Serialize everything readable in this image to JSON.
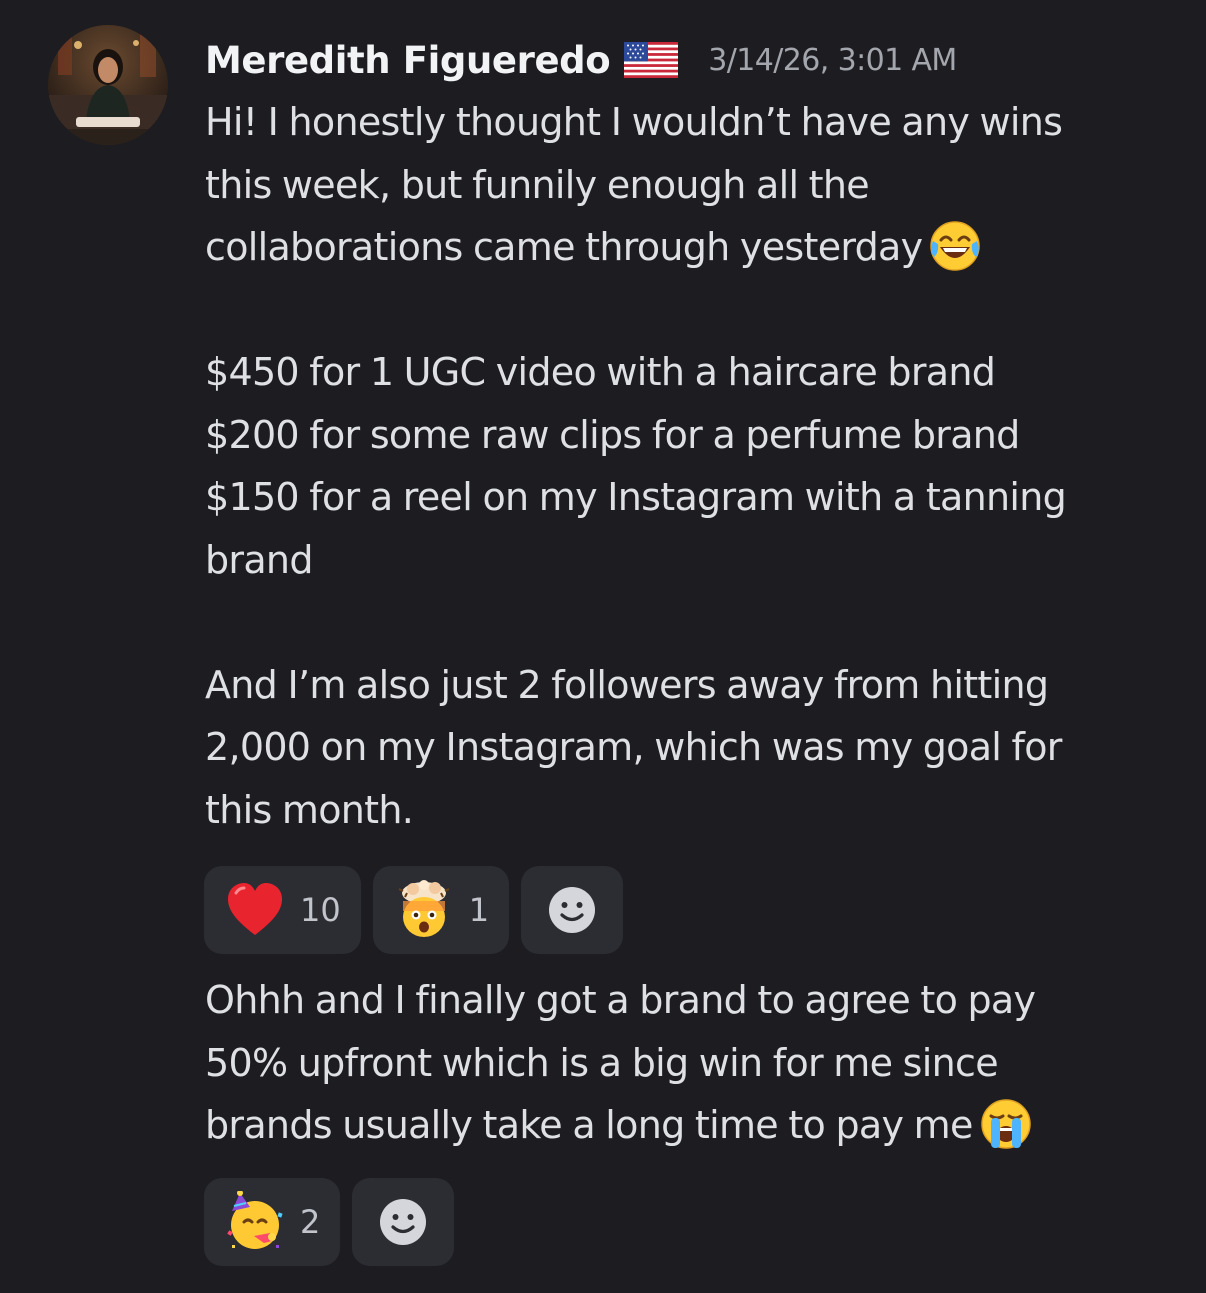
{
  "author": {
    "name": "Meredith Figueredo",
    "flag_icon": "us-flag-icon",
    "timestamp": "3/14/26, 3:01 AM"
  },
  "message1": {
    "lines": [
      "Hi! I honestly thought I wouldn’t have any wins",
      "this week, but funnily enough all the",
      "collaborations came through yesterday",
      "",
      "$450 for 1 UGC video with a haircare brand",
      "$200 for some raw clips for a perfume brand",
      "$150 for a reel on my Instagram with a tanning",
      "brand",
      "",
      "And I’m also just 2 followers away from hitting",
      "2,000 on my Instagram, which was my goal for",
      "this month."
    ],
    "trailing_emoji": "tears-of-joy-emoji",
    "reactions": [
      {
        "emoji": "red-heart-emoji",
        "count": "10"
      },
      {
        "emoji": "exploding-head-emoji",
        "count": "1"
      }
    ]
  },
  "message2": {
    "lines": [
      "Ohhh and I finally got a brand to agree to pay",
      "50% upfront  which is a big win for me since",
      "brands usually take a long time to pay me"
    ],
    "trailing_emoji": "loudly-crying-emoji",
    "reactions": [
      {
        "emoji": "partying-face-emoji",
        "count": "2"
      }
    ]
  },
  "colors": {
    "background": "#1c1c21",
    "reaction_bg": "#2c2d33",
    "username": "#f2f3f5",
    "text": "#dfe0e4",
    "timestamp": "#a4a6ad"
  }
}
